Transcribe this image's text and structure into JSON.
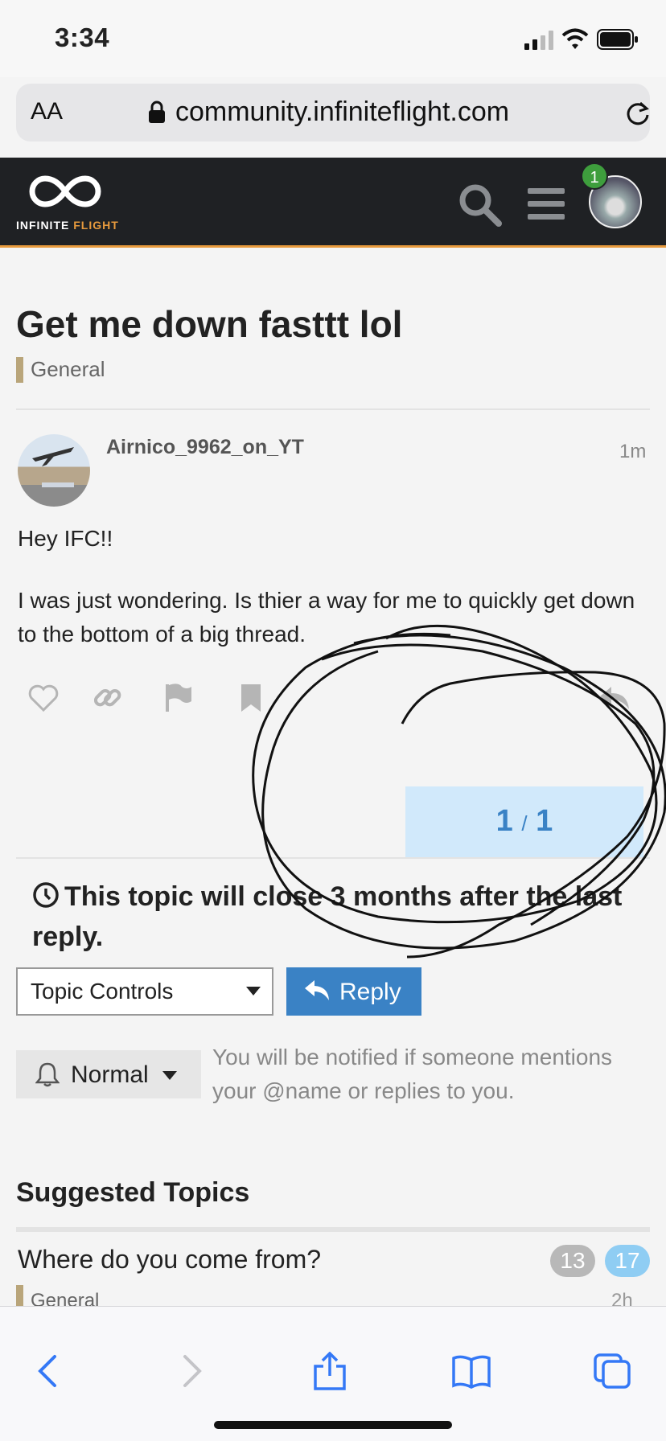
{
  "status_bar": {
    "time": "3:34"
  },
  "browser": {
    "font_control": "AA",
    "url": "community.infiniteflight.com"
  },
  "site": {
    "brand_line1": "INFINITE",
    "brand_line2": "FLIGHT",
    "notification_count": "1",
    "accent_color": "#e79a3d"
  },
  "topic": {
    "title": "Get me down fasttt lol",
    "category": "General",
    "category_color": "#b9a57a"
  },
  "post": {
    "username": "Airnico_9962_on_YT",
    "age": "1m",
    "paragraph1": "Hey IFC!!",
    "paragraph2": "I was just wondering. Is thier a way for me to quickly get down to the bottom of a big thread.",
    "actions": [
      "heart-icon",
      "link-icon",
      "flag-icon",
      "bookmark-icon",
      "reply-arrow-icon"
    ]
  },
  "progress": {
    "current": "1",
    "total": "1"
  },
  "closing_notice": "This topic will close 3 months after the last reply.",
  "controls": {
    "topic_controls_label": "Topic Controls",
    "reply_label": "Reply",
    "notification_level": "Normal",
    "notification_desc": "You will be notified if someone mentions your @name or replies to you."
  },
  "suggested": {
    "heading": "Suggested Topics",
    "topics": [
      {
        "title": "Where do you come from?",
        "category": "General",
        "replies": "13",
        "unread": "17",
        "age": "2h"
      }
    ]
  },
  "colors": {
    "reply_button": "#3a82c5",
    "progress_bg": "#d1e9fb",
    "header_bg": "#1f2124"
  }
}
